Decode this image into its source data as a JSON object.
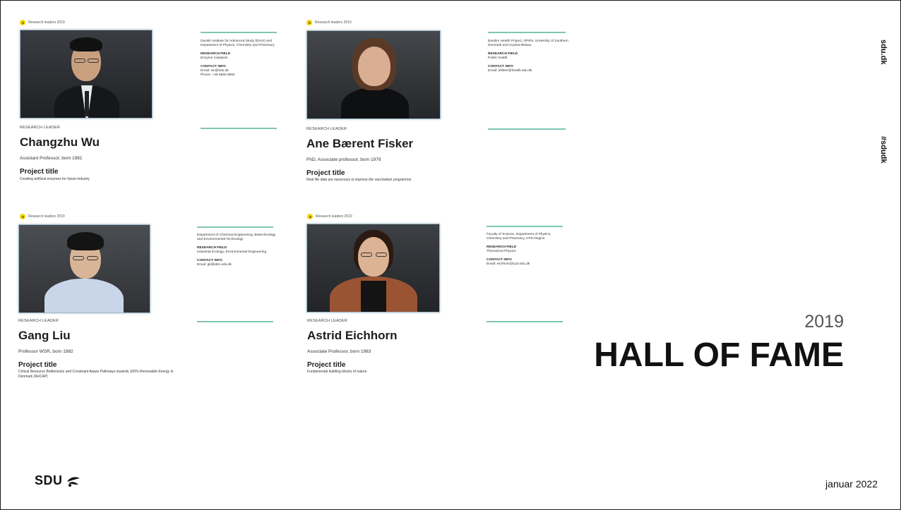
{
  "sidebar": {
    "site": "sdu.dk",
    "hashtag": "#sdudk"
  },
  "hero": {
    "year": "2019",
    "title": "HALL OF FAME"
  },
  "footer": {
    "logo_text": "SDU",
    "date": "januar 2022"
  },
  "colors": {
    "accent_rule": "#7fc5b5",
    "badge_yellow": "#f2d600"
  },
  "cards": [
    {
      "badge": "Research leaders 2019",
      "role": "RESEARCH LEADER",
      "name": "Changzhu Wu",
      "subtitle": "Assistant Professor, born 1981",
      "project_label": "Project title",
      "project": "Creating artificial enzymes for future industry",
      "institution": "Danish Institute for Advanced Study (DIAS) and Department of Physics, Chemistry and Pharmacy",
      "field_label": "RESEARCH FIELD",
      "field": "Enzyme Catalysis",
      "contact_label": "CONTACT INFO",
      "contact": "Email: wu@sdu.dk\nPhone: +45 6550 8654"
    },
    {
      "badge": "Research leaders 2019",
      "role": "RESEARCH LEADER",
      "name": "Ane Bærent Fisker",
      "subtitle": "PhD, Associate professor, born 1979",
      "project_label": "Project title",
      "project": "Real life data are necessary to improve the vaccination programme",
      "institution": "Bandim Health Project, OPEN, University of Southern Denmark and Guinea-Bissau",
      "field_label": "RESEARCH FIELD",
      "field": "Public health",
      "contact_label": "CONTACT INFO",
      "contact": "Email: afisker@health.sdu.dk"
    },
    {
      "badge": "Research leaders 2019",
      "role": "RESEARCH LEADER",
      "name": "Gang Liu",
      "subtitle": "Professor WSR, born 1982",
      "project_label": "Project title",
      "project": "Critical Resource Bottlenecks and Constraint Aware Pathways towards 100% Renewable Energy in Denmark (ReCAP)",
      "institution": "Department of Chemical Engineering, Biotechnology and Environmental Technology",
      "field_label": "RESEARCH FIELD",
      "field": "Industrial Ecology; Environmental Engineering",
      "contact_label": "CONTACT INFO",
      "contact": "Email: gli@kbm.sdu.dk"
    },
    {
      "badge": "Research leaders 2019",
      "role": "RESEARCH LEADER",
      "name": "Astrid Eichhorn",
      "subtitle": "Associate Professor, born 1983",
      "project_label": "Project title",
      "project": "Fundamental building blocks of nature",
      "institution": "Faculty of Science, Department of Physics, Chemistry and Pharmacy, CP3-Origins",
      "field_label": "RESEARCH FIELD",
      "field": "Theoretical Physics",
      "contact_label": "CONTACT INFO",
      "contact": "Email: eichhorn@cp3.sdu.dk"
    }
  ]
}
